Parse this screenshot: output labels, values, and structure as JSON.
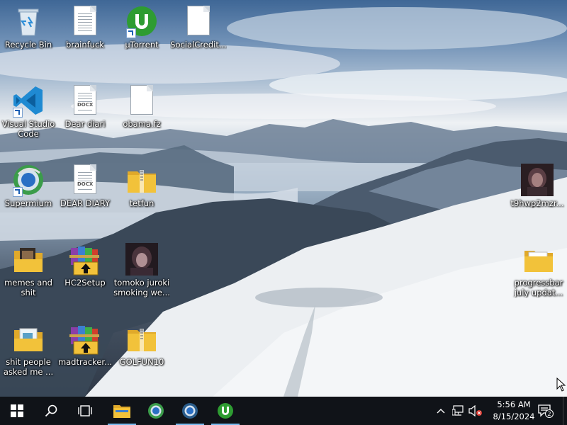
{
  "desktop": {
    "icons": [
      {
        "id": "recycle-bin",
        "label": "Recycle Bin"
      },
      {
        "id": "brainfuck",
        "label": "brainfuck"
      },
      {
        "id": "utorrent",
        "label": "µTorrent"
      },
      {
        "id": "socialcredit",
        "label": "SocialCredit..."
      },
      {
        "id": "vscode",
        "label": "Visual Studio Code"
      },
      {
        "id": "dear-diari",
        "label": "Dear diari"
      },
      {
        "id": "obama-fz",
        "label": "obama.fz"
      },
      {
        "id": "supermium",
        "label": "Supermium"
      },
      {
        "id": "dear-diary",
        "label": "DEAR DIARY"
      },
      {
        "id": "tetfun",
        "label": "tetfun"
      },
      {
        "id": "t9hwp2mzr",
        "label": "t9hwp2mzr..."
      },
      {
        "id": "memes-and-shit",
        "label": "memes and shit"
      },
      {
        "id": "hc2setup",
        "label": "HC2Setup"
      },
      {
        "id": "tomoko",
        "label": "tomoko juroki smoking we..."
      },
      {
        "id": "progressbar",
        "label": "progressbar july updat..."
      },
      {
        "id": "shit-people",
        "label": "shit people asked me ..."
      },
      {
        "id": "madtracker",
        "label": "madtracker..."
      },
      {
        "id": "golfun10",
        "label": "GOLFUN10"
      }
    ],
    "docx_tag": "DOCX"
  },
  "taskbar": {
    "start_icon": "windows-logo-icon",
    "search_icon": "search-icon",
    "task_view_icon": "task-view-icon",
    "pinned": [
      {
        "name": "file-explorer",
        "icon": "folder-icon",
        "active": true
      },
      {
        "name": "supermium-1",
        "icon": "globe-icon",
        "active": false
      },
      {
        "name": "supermium-2",
        "icon": "globe-icon",
        "active": true
      },
      {
        "name": "utorrent",
        "icon": "utorrent-icon",
        "active": true
      }
    ],
    "clock": {
      "time": "5:56 AM",
      "date": "8/15/2024"
    },
    "notification_count": "2"
  },
  "colors": {
    "taskbar_bg": "#101318",
    "active_indicator": "#76b9ed",
    "utorrent_green": "#2e9c32",
    "vscode_blue": "#1f8ad2",
    "folder_yellow": "#f2c23a"
  }
}
